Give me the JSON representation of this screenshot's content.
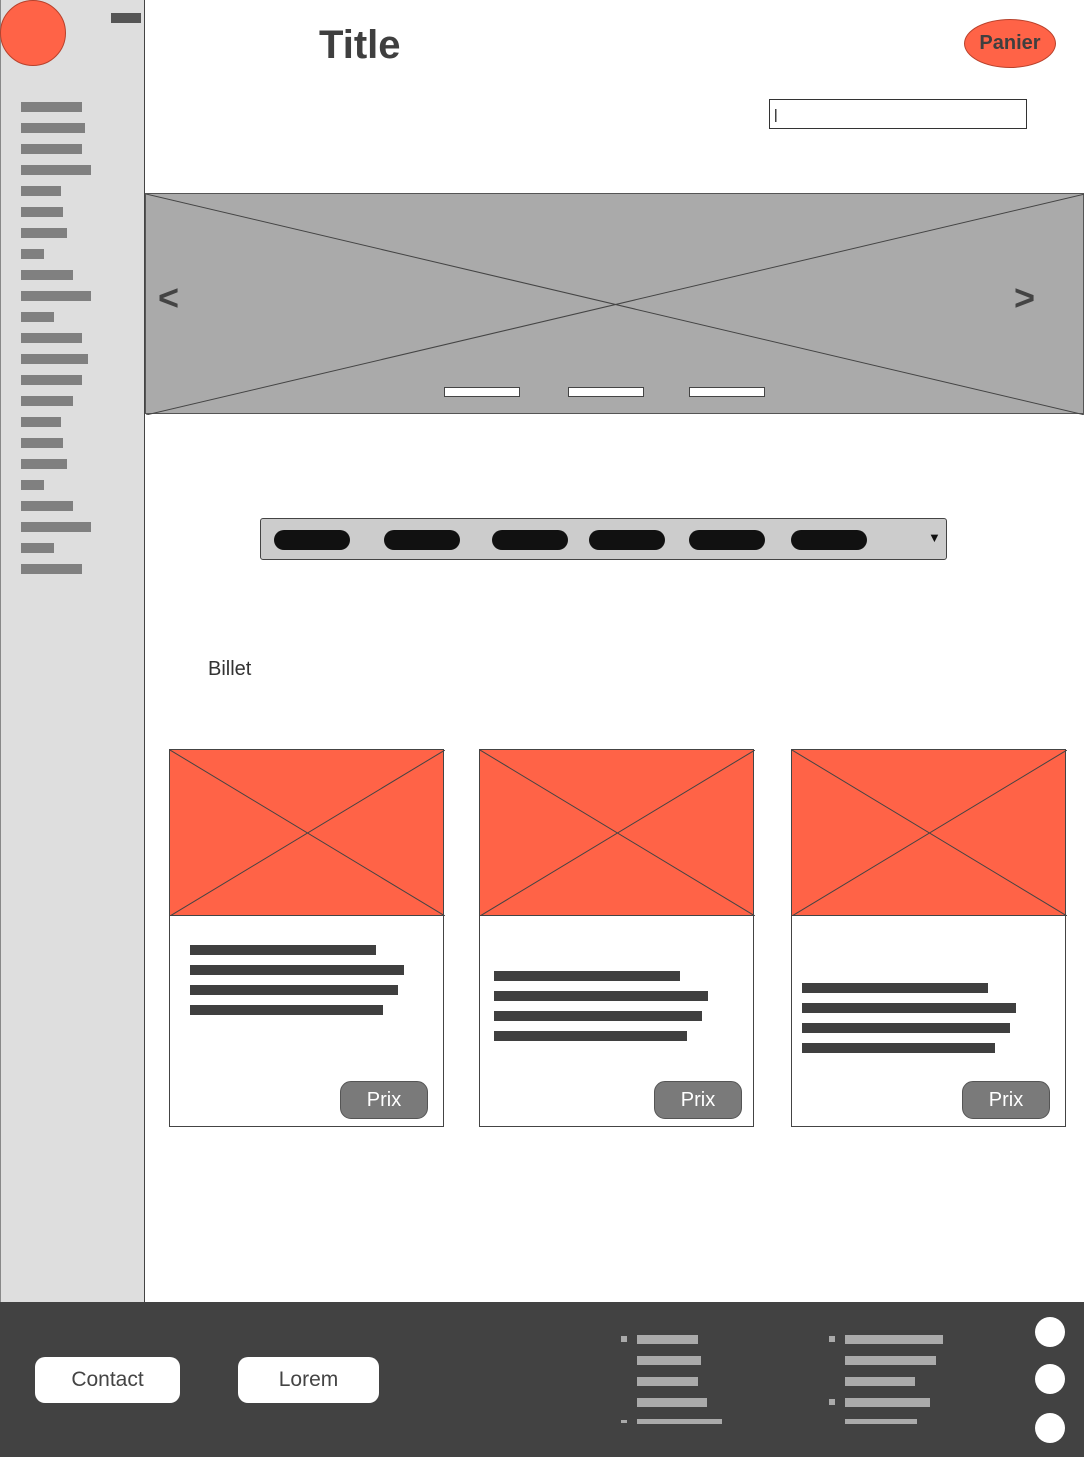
{
  "header": {
    "title": "Title",
    "cart_label": "Panier",
    "search_value": "|",
    "search_placeholder": ""
  },
  "carousel": {
    "prev_label": "<",
    "next_label": ">",
    "slide_count": 3
  },
  "filter": {
    "option_count": 6,
    "caret": "▼"
  },
  "section": {
    "label": "Billet"
  },
  "cards": [
    {
      "price_label": "Prix"
    },
    {
      "price_label": "Prix"
    },
    {
      "price_label": "Prix"
    }
  ],
  "footer": {
    "contact_label": "Contact",
    "lorem_label": "Lorem"
  },
  "colors": {
    "accent": "#ff6347",
    "sidebar_bg": "#dedede",
    "footer_bg": "#424242",
    "carousel_bg": "#aaaaaa"
  }
}
